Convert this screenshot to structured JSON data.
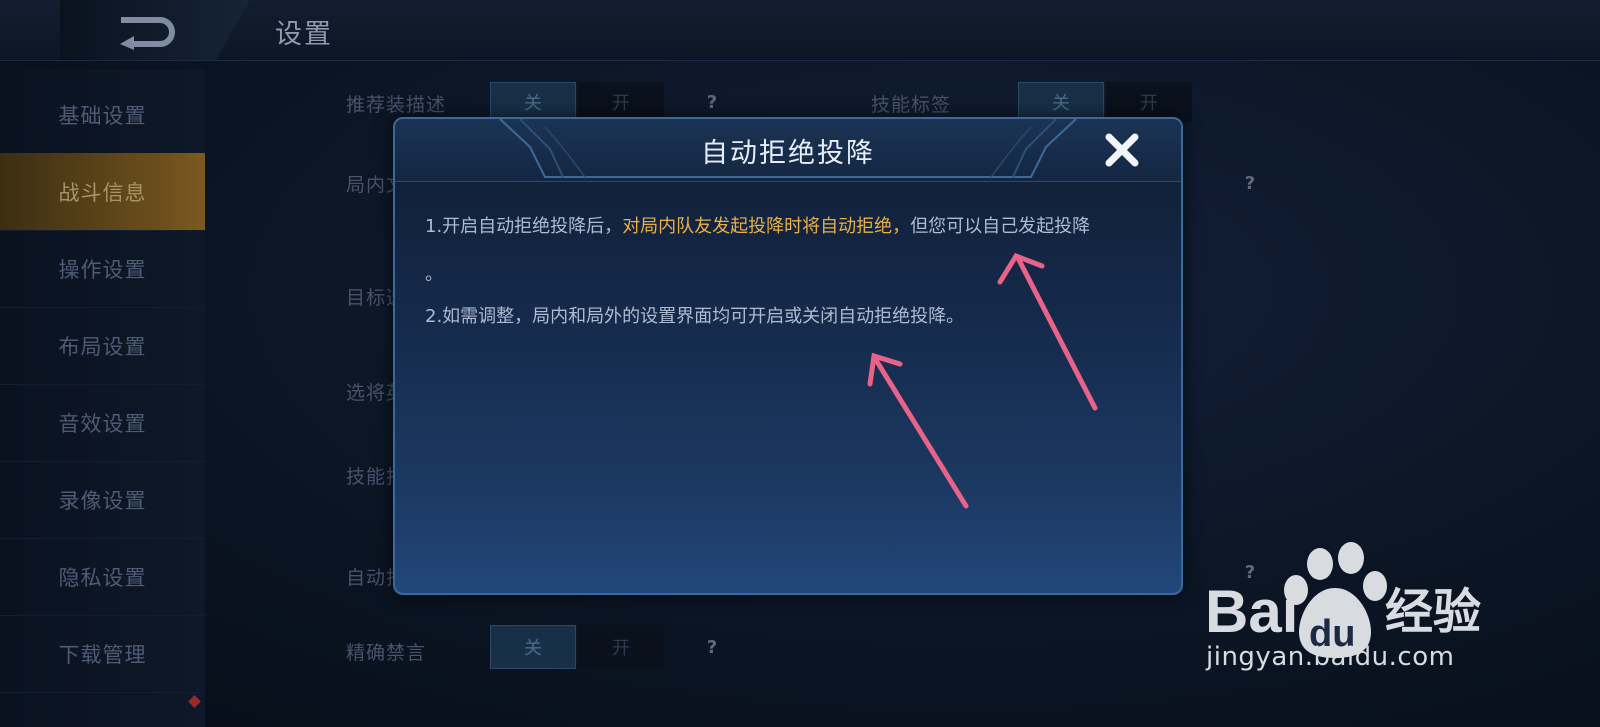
{
  "header": {
    "title": "设置",
    "back_icon": "back-arrow-icon"
  },
  "sidebar": {
    "items": [
      {
        "label": "基础设置",
        "active": false
      },
      {
        "label": "战斗信息",
        "active": true
      },
      {
        "label": "操作设置",
        "active": false
      },
      {
        "label": "布局设置",
        "active": false
      },
      {
        "label": "音效设置",
        "active": false
      },
      {
        "label": "录像设置",
        "active": false
      },
      {
        "label": "隐私设置",
        "active": false
      },
      {
        "label": "下载管理",
        "active": false
      }
    ]
  },
  "settings": {
    "row1_label": "推荐装描述",
    "row1_off": "关",
    "row1_on": "开",
    "row1_help": "?",
    "row1b_label": "技能标签",
    "row1b_off": "关",
    "row1b_on": "开",
    "row2_label": "局内文",
    "row2_help": "?",
    "row3_label": "目标选",
    "row4_label": "选将英",
    "row5_label": "技能指",
    "row6_label": "自动拒",
    "row6_help": "?",
    "row7_label": "精确禁言",
    "row7_off": "关",
    "row7_on": "开",
    "row7_help": "?"
  },
  "dialog": {
    "title": "自动拒绝投降",
    "close_icon": "close-icon",
    "para1_prefix": "1.开启自动拒绝投降后，",
    "para1_highlight": "对局内队友发起投降时将自动拒绝，",
    "para1_suffix": "但您可以自己发起投降",
    "para1_end": "。",
    "para2": "2.如需调整，局内和局外的设置界面均可开启或关闭自动拒绝投降。",
    "highlight_color": "#e8b04a"
  },
  "watermark": {
    "brand_prefix": "Bai",
    "brand_mid": "du",
    "brand_cn": "经验",
    "url": "jingyan.baidu.com"
  },
  "colors": {
    "accent_gold": "#7c5920",
    "dialog_border": "#3b6a9a",
    "annotation_arrow": "#e8638a"
  }
}
